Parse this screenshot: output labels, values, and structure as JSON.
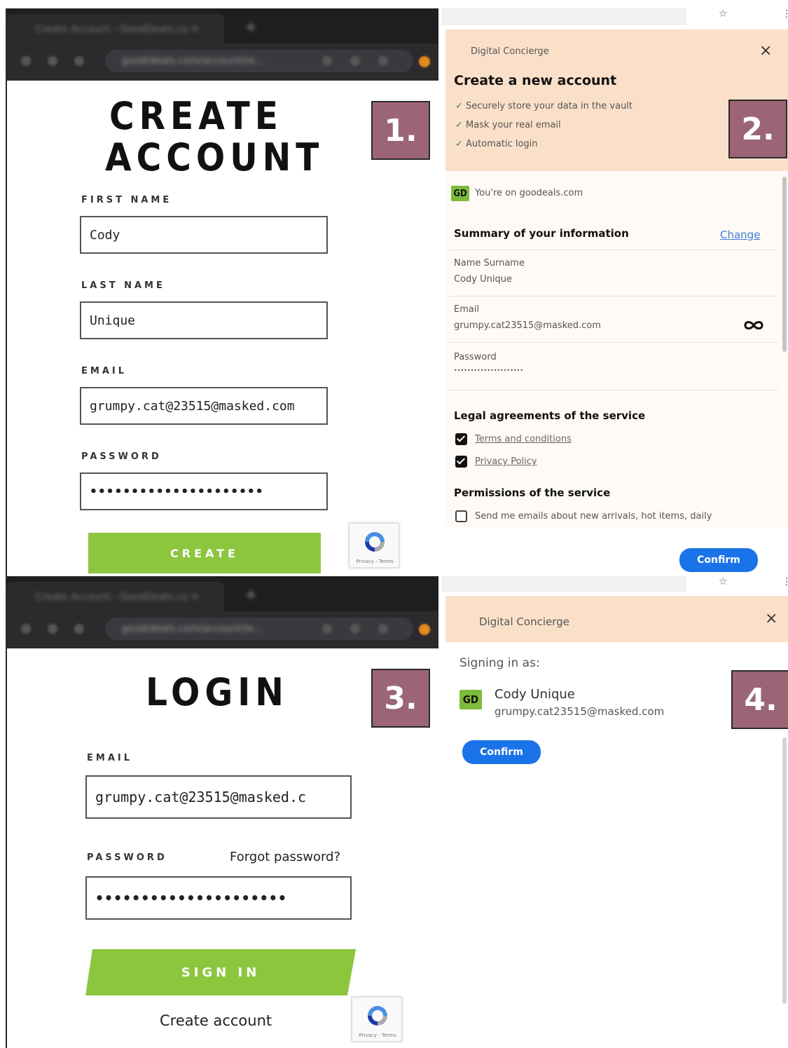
{
  "badges": [
    "1.",
    "2.",
    "3.",
    "4."
  ],
  "site_signup": {
    "title_line1": "CREATE",
    "title_line2": "ACCOUNT",
    "first_name_label": "FIRST NAME",
    "first_name_value": "Cody",
    "last_name_label": "LAST NAME",
    "last_name_value": "Unique",
    "email_label": "EMAIL",
    "email_value": "grumpy.cat@23515@masked.com",
    "password_label": "PASSWORD",
    "password_value": "•••••••••••••••••••••",
    "create_button": "CREATE"
  },
  "concierge_signup": {
    "app_name": "Digital Concierge",
    "heading": "Create a new account",
    "features": [
      "Securely store your data in the vault",
      "Mask your real email",
      "Automatic login"
    ],
    "site_badge": "GD",
    "site_text": "You're on goodeals.com",
    "summary_title": "Summary of your information",
    "change_link": "Change",
    "name_label": "Name Surname",
    "name_value": "Cody Unique",
    "email_label": "Email",
    "email_value": "grumpy.cat23515@masked.com",
    "password_label": "Password",
    "password_value": "•••••••••••••••••••••",
    "legal_title": "Legal agreements of the service",
    "terms_link": "Terms and conditions",
    "privacy_link": "Privacy Policy",
    "permissions_title": "Permissions of the service",
    "permission_text": "Send me emails about new arrivals, hot items, daily",
    "confirm_button": "Confirm",
    "close_icon": "×"
  },
  "site_login": {
    "title": "LOGIN",
    "email_label": "EMAIL",
    "email_value": "grumpy.cat@23515@masked.c",
    "password_label": "PASSWORD",
    "forgot_link": "Forgot password?",
    "password_value": "•••••••••••••••••••••",
    "signin_button": "SIGN IN",
    "create_link": "Create account"
  },
  "concierge_login": {
    "app_name": "Digital Concierge",
    "signing_in_as": "Signing in as:",
    "site_badge": "GD",
    "user_name": "Cody Unique",
    "user_email": "grumpy.cat23515@masked.com",
    "confirm_button": "Confirm",
    "close_icon": "×"
  },
  "recaptcha": {
    "footer": "Privacy - Terms"
  },
  "colors": {
    "badge": "#9b6575",
    "green_button": "#8cc63f",
    "blue_button": "#1a73e8",
    "peach": "#fbe0c9"
  }
}
